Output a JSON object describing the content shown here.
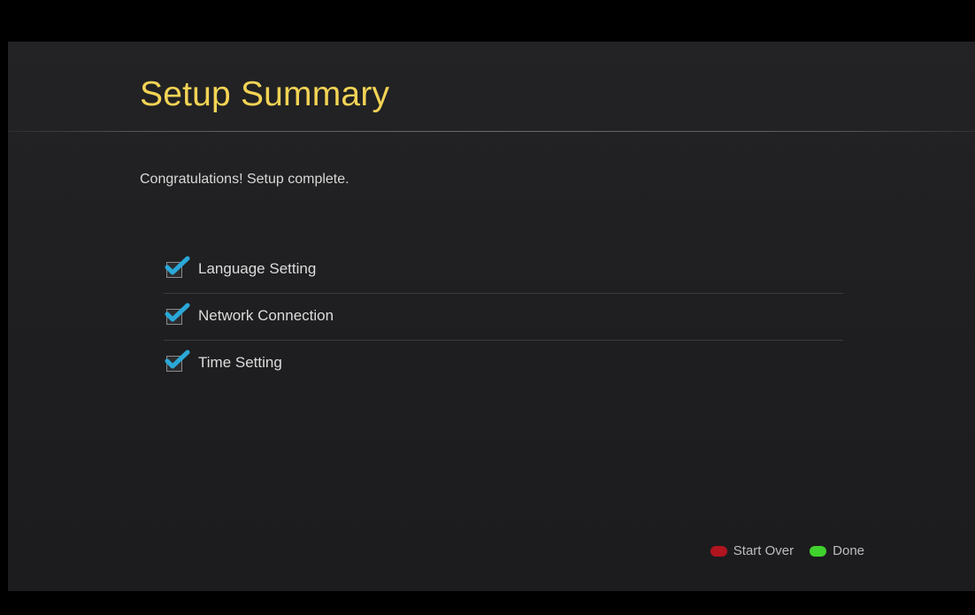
{
  "page": {
    "title": "Setup Summary",
    "message": "Congratulations! Setup complete."
  },
  "checklist": [
    {
      "label": "Language Setting",
      "checked": true
    },
    {
      "label": "Network Connection",
      "checked": true
    },
    {
      "label": "Time Setting",
      "checked": true
    }
  ],
  "footer": {
    "start_over_label": "Start Over",
    "done_label": "Done"
  },
  "colors": {
    "title": "#f3d355",
    "check": "#2aa8d8",
    "red_key": "#b0141f",
    "green_key": "#3fd12c"
  },
  "icons": {
    "check": "checkmark-icon",
    "red_key": "red-key-icon",
    "green_key": "green-key-icon"
  }
}
